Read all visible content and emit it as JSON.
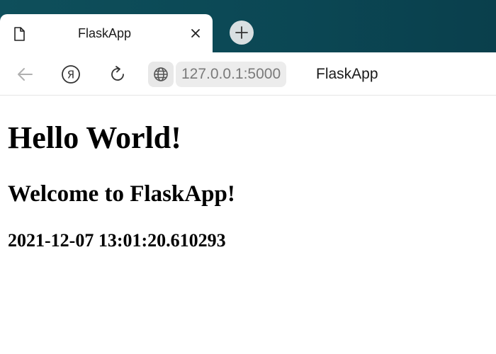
{
  "browser": {
    "tab": {
      "title": "FlaskApp",
      "icon": "document-icon",
      "close_icon": "close-icon"
    },
    "new_tab_icon": "plus-icon",
    "toolbar": {
      "back_icon": "back-arrow-icon",
      "yandex_icon": "yandex-icon",
      "reload_icon": "reload-icon",
      "site_info_icon": "globe-icon",
      "address": "127.0.0.1:5000",
      "page_title": "FlaskApp"
    },
    "colors": {
      "tabbar": "#0b4754",
      "address_text": "#7a7a7a"
    }
  },
  "page": {
    "heading1": "Hello World!",
    "heading2": "Welcome to FlaskApp!",
    "heading3": "2021-12-07 13:01:20.610293"
  }
}
